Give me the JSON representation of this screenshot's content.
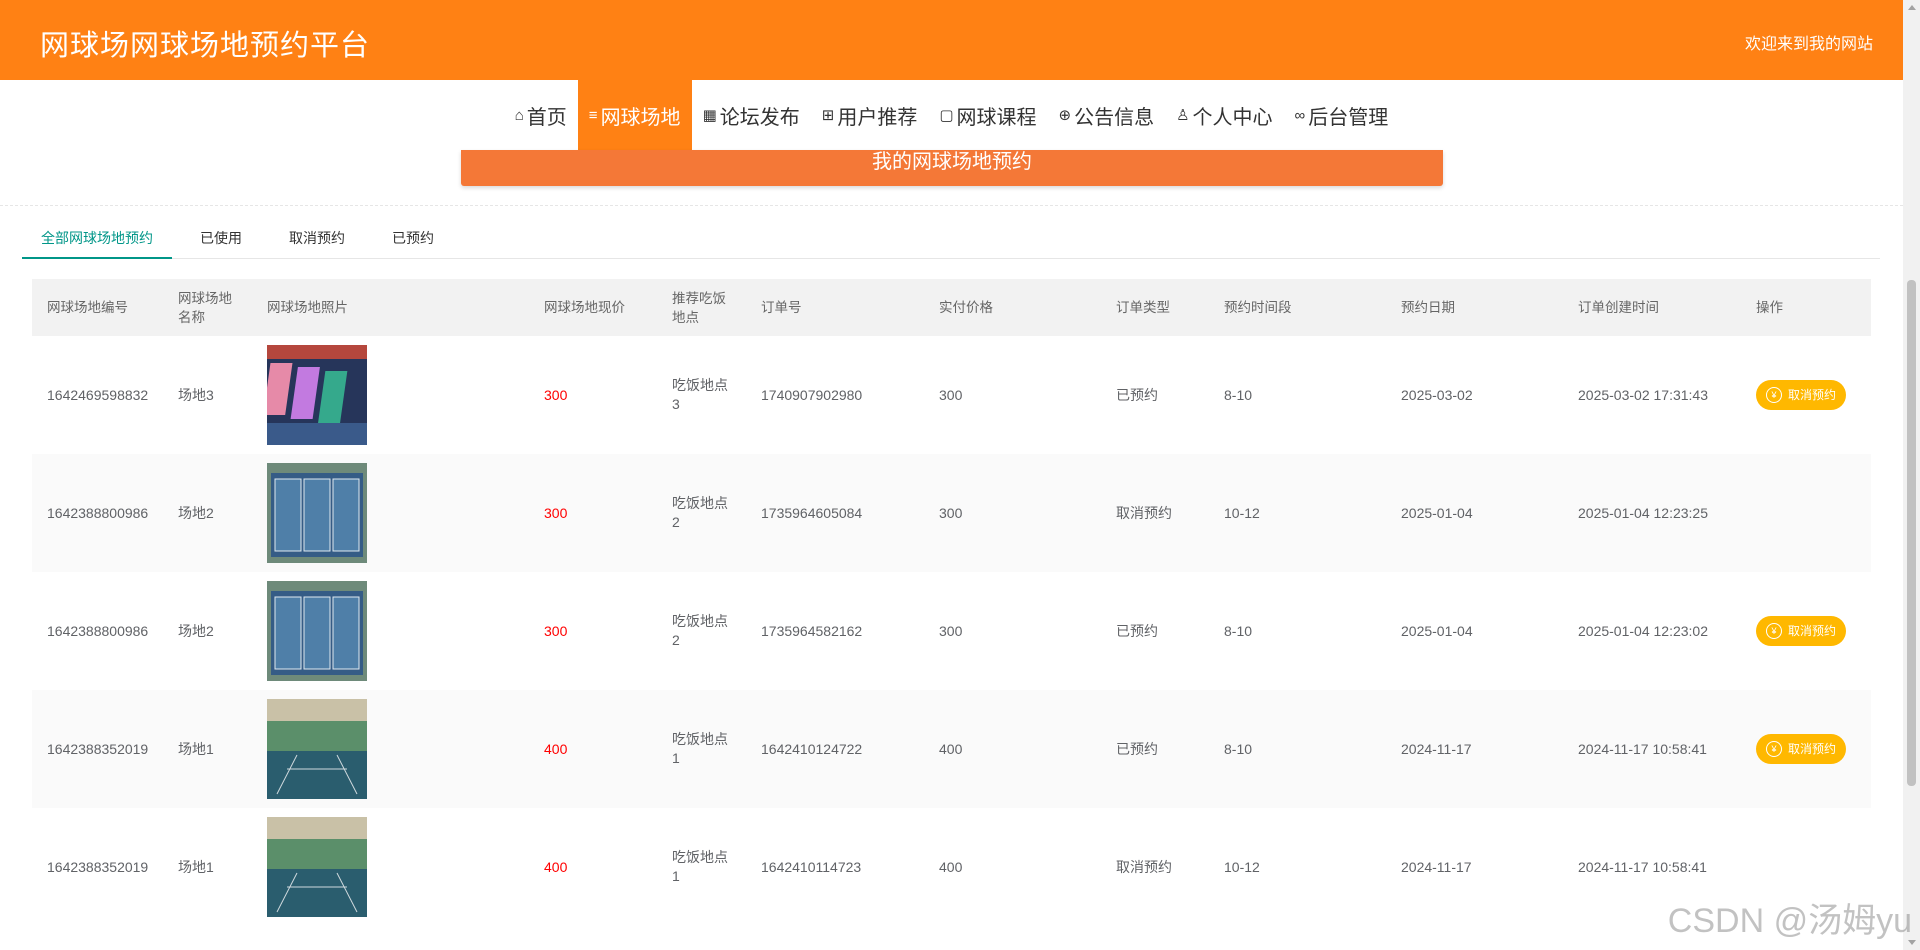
{
  "site": {
    "title": "网球场网球场地预约平台",
    "welcome": "欢迎来到我的网站"
  },
  "nav": [
    {
      "label": "首页",
      "icon": "home-icon",
      "glyph": "⌂",
      "active": false
    },
    {
      "label": "网球场地",
      "icon": "sliders-icon",
      "glyph": "≡",
      "active": true
    },
    {
      "label": "论坛发布",
      "icon": "calendar-icon",
      "glyph": "▦",
      "active": false
    },
    {
      "label": "用户推荐",
      "icon": "gift-icon",
      "glyph": "⊞",
      "active": false
    },
    {
      "label": "网球课程",
      "icon": "note-icon",
      "glyph": "▢",
      "active": false
    },
    {
      "label": "公告信息",
      "icon": "globe-icon",
      "glyph": "⊕",
      "active": false
    },
    {
      "label": "个人中心",
      "icon": "user-icon",
      "glyph": "♙",
      "active": false
    },
    {
      "label": "后台管理",
      "icon": "link-icon",
      "glyph": "∞",
      "active": false
    }
  ],
  "banner": {
    "title": "我的网球场地预约"
  },
  "tabs": [
    {
      "label": "全部网球场地预约",
      "active": true
    },
    {
      "label": "已使用",
      "active": false
    },
    {
      "label": "取消预约",
      "active": false
    },
    {
      "label": "已预约",
      "active": false
    }
  ],
  "table": {
    "headers": [
      "网球场地编号",
      "网球场地名称",
      "网球场地照片",
      "网球场地现价",
      "推荐吃饭地点",
      "订单号",
      "实付价格",
      "订单类型",
      "预约时间段",
      "预约日期",
      "订单创建时间",
      "操作"
    ],
    "cancel_label": "取消预约",
    "rows": [
      {
        "code": "1642469598832",
        "name": "场地3",
        "photo": "court-photo-3",
        "price": "300",
        "food": "吃饭地点3",
        "order_no": "1740907902980",
        "paid": "300",
        "type": "已预约",
        "slot": "8-10",
        "date": "2025-03-02",
        "created": "2025-03-02 17:31:43",
        "can_cancel": true
      },
      {
        "code": "1642388800986",
        "name": "场地2",
        "photo": "court-photo-2",
        "price": "300",
        "food": "吃饭地点2",
        "order_no": "1735964605084",
        "paid": "300",
        "type": "取消预约",
        "slot": "10-12",
        "date": "2025-01-04",
        "created": "2025-01-04 12:23:25",
        "can_cancel": false
      },
      {
        "code": "1642388800986",
        "name": "场地2",
        "photo": "court-photo-2",
        "price": "300",
        "food": "吃饭地点2",
        "order_no": "1735964582162",
        "paid": "300",
        "type": "已预约",
        "slot": "8-10",
        "date": "2025-01-04",
        "created": "2025-01-04 12:23:02",
        "can_cancel": true
      },
      {
        "code": "1642388352019",
        "name": "场地1",
        "photo": "court-photo-1",
        "price": "400",
        "food": "吃饭地点1",
        "order_no": "1642410124722",
        "paid": "400",
        "type": "已预约",
        "slot": "8-10",
        "date": "2024-11-17",
        "created": "2024-11-17 10:58:41",
        "can_cancel": true
      },
      {
        "code": "1642388352019",
        "name": "场地1",
        "photo": "court-photo-1",
        "price": "400",
        "food": "吃饭地点1",
        "order_no": "1642410114723",
        "paid": "400",
        "type": "取消预约",
        "slot": "10-12",
        "date": "2024-11-17",
        "created": "2024-11-17 10:58:41",
        "can_cancel": false
      }
    ]
  },
  "watermark": "CSDN @汤姆yu",
  "colors": {
    "brand": "#ff8114",
    "banner": "#f47837",
    "tab_active": "#009688",
    "price": "#ff0000",
    "cancel_button": "#ffb800"
  }
}
